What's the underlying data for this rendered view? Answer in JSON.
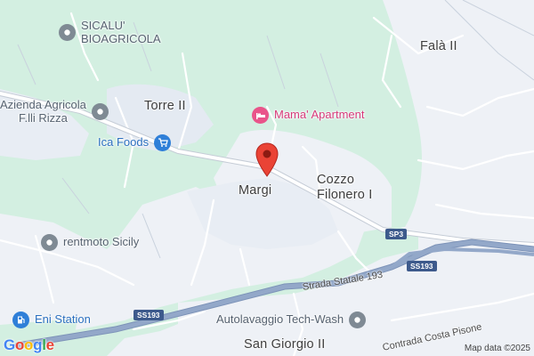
{
  "map": {
    "areas": {
      "torre": "Torre II",
      "fala": "Falà II",
      "margi": "Margi",
      "cozzo": "Cozzo\nFilonero I",
      "san_giorgio": "San Giorgio II"
    },
    "pois": {
      "sicalu": "SICALU'\nBIOAGRICOLA",
      "azienda": "Azienda Agricola\nF.lli Rizza",
      "mama": "Mama' Apartment",
      "ica": "Ica Foods",
      "rentmoto": "rentmoto Sicily",
      "eni": "Eni Station",
      "autolavaggio": "Autolavaggio Tech-Wash"
    },
    "roads": {
      "sp3": "SP3",
      "ss193_a": "SS193",
      "ss193_b": "SS193",
      "strada_statale": "Strada Statale 193",
      "contrada": "Contrada Costa Pisone"
    },
    "logo": "Google",
    "attribution": "Map data ©2025",
    "colors": {
      "land": "#eef1f6",
      "green": "#d3efe1",
      "highway": "#8ea3c4",
      "marker": "#ea4335"
    }
  }
}
